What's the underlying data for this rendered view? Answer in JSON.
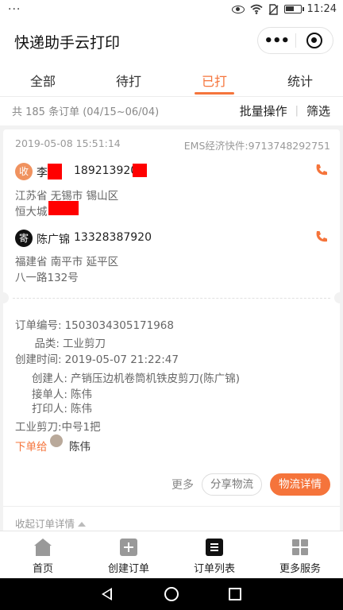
{
  "status_bar": {
    "overflow": "···",
    "time": "11:24",
    "icons": [
      "eye-icon",
      "wifi-icon",
      "no-sim-icon",
      "battery-icon"
    ],
    "battery_level": 0.55
  },
  "header": {
    "title": "快递助手云打印",
    "menu_icon": "ellipsis-icon",
    "close_icon": "target-icon"
  },
  "tabs": [
    {
      "label": "全部",
      "active": false
    },
    {
      "label": "待打",
      "active": false
    },
    {
      "label": "已打",
      "active": true
    },
    {
      "label": "统计",
      "active": false
    }
  ],
  "summary": {
    "count_text": "共 185 条订单 (04/15~06/04)",
    "batch_label": "批量操作",
    "divider": "|",
    "filter_label": "筛选"
  },
  "order": {
    "date": "2019-05-08 15:51:14",
    "express": "EMS经济快件:9713748292751",
    "receiver": {
      "badge": "收",
      "name": "李",
      "phone": "189213920",
      "address_line1": "江苏省 无锡市 锡山区",
      "address_line2": "恒大城"
    },
    "sender": {
      "badge": "寄",
      "name": "陈广锦",
      "phone": "13328387920",
      "address_line1": "福建省 南平市 延平区",
      "address_line2": "八一路132号"
    },
    "info": [
      {
        "key": "订单编号:",
        "value": "1503034305171968"
      },
      {
        "key": "品类:",
        "value": "工业剪刀"
      },
      {
        "key": "创建时间:",
        "value": "2019-05-07 21:22:47"
      },
      {
        "key": "创建人:",
        "value": "产销压边机卷筒机铁皮剪刀(陈广锦)"
      },
      {
        "key": "接单人:",
        "value": "陈伟"
      },
      {
        "key": "打印人:",
        "value": "陈伟"
      }
    ],
    "item_line": "工业剪刀:中号1把",
    "assign_label": "下单给",
    "assignee": "陈伟",
    "more_label": "更多",
    "share_label": "分享物流",
    "detail_label": "物流详情",
    "collapse_label": "收起订单详情",
    "accent_color": "#f5743b"
  },
  "bottom_nav": [
    {
      "label": "首页",
      "icon": "home-icon"
    },
    {
      "label": "创建订单",
      "icon": "plus-square-icon"
    },
    {
      "label": "订单列表",
      "icon": "list-icon"
    },
    {
      "label": "更多服务",
      "icon": "grid-icon"
    }
  ]
}
